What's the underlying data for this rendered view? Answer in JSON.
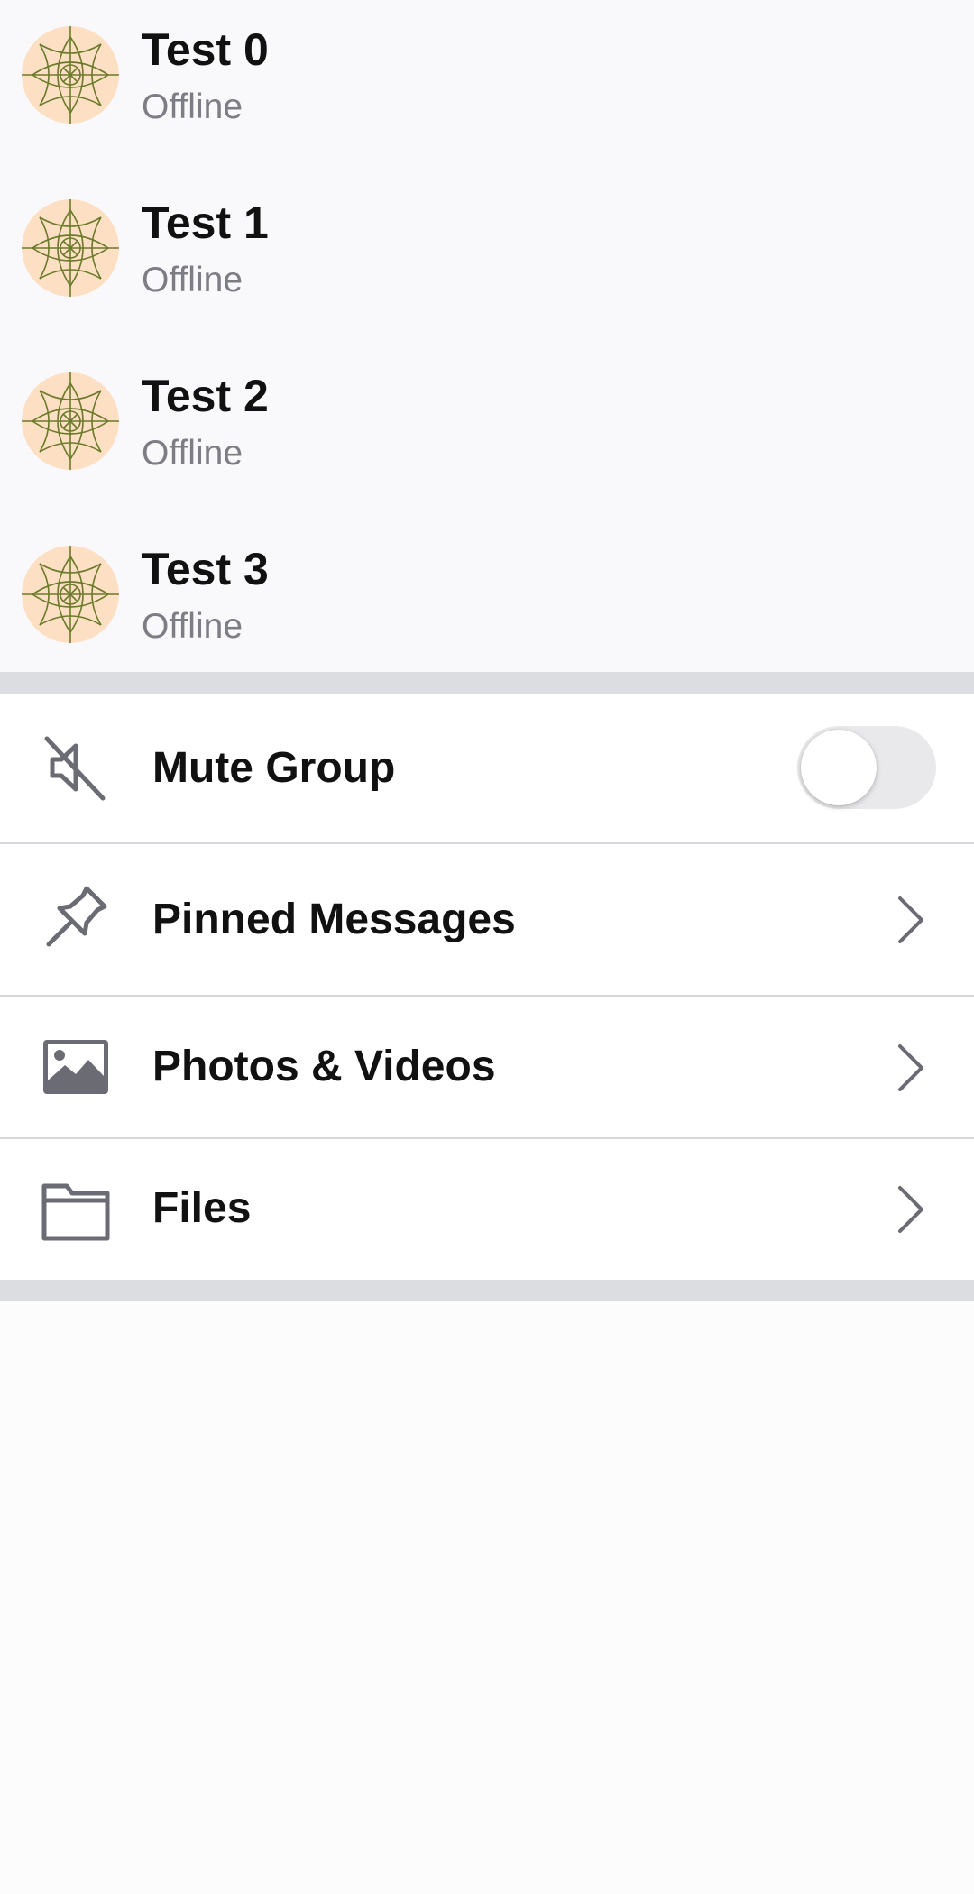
{
  "members": [
    {
      "name": "Test 0",
      "status": "Offline"
    },
    {
      "name": "Test 1",
      "status": "Offline"
    },
    {
      "name": "Test 2",
      "status": "Offline"
    },
    {
      "name": "Test 3",
      "status": "Offline"
    }
  ],
  "settings": {
    "mute": {
      "label": "Mute Group",
      "enabled": false,
      "icon": "speaker-muted-icon"
    },
    "pinned": {
      "label": "Pinned Messages",
      "icon": "pin-icon"
    },
    "photos": {
      "label": "Photos & Videos",
      "icon": "image-icon"
    },
    "files": {
      "label": "Files",
      "icon": "folder-icon"
    }
  },
  "colors": {
    "avatar_background": "#fddfc4",
    "avatar_pattern": "#6a7a2a",
    "icon_gray": "#6b6b73",
    "separator": "#dcdde0"
  }
}
